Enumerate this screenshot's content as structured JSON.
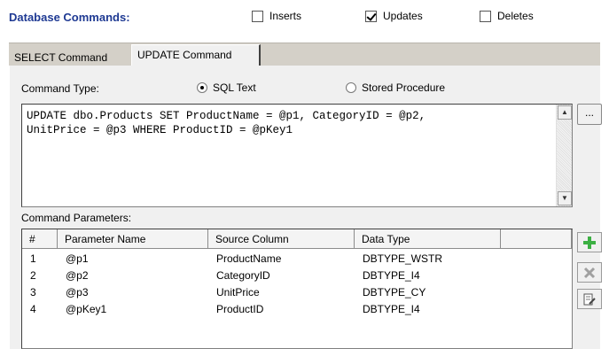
{
  "header": {
    "title": "Database Commands:",
    "checkboxes": [
      {
        "label": "Inserts",
        "checked": false
      },
      {
        "label": "Updates",
        "checked": true
      },
      {
        "label": "Deletes",
        "checked": false
      }
    ]
  },
  "tabs": [
    {
      "label": "SELECT Command",
      "active": false
    },
    {
      "label": "UPDATE Command",
      "active": true
    }
  ],
  "command_type": {
    "label": "Command Type:",
    "options": [
      {
        "label": "SQL Text",
        "selected": true
      },
      {
        "label": "Stored Procedure",
        "selected": false
      }
    ]
  },
  "sql": {
    "text": "UPDATE dbo.Products SET ProductName = @p1, CategoryID = @p2,\nUnitPrice = @p3 WHERE ProductID = @pKey1",
    "ellipsis_label": "..."
  },
  "parameters": {
    "label": "Command Parameters:",
    "columns": [
      "#",
      "Parameter Name",
      "Source Column",
      "Data Type",
      ""
    ],
    "rows": [
      [
        "1",
        "@p1",
        "ProductName",
        "DBTYPE_WSTR"
      ],
      [
        "2",
        "@p2",
        "CategoryID",
        "DBTYPE_I4"
      ],
      [
        "3",
        "@p3",
        "UnitPrice",
        "DBTYPE_CY"
      ],
      [
        "4",
        "@pKey1",
        "ProductID",
        "DBTYPE_I4"
      ]
    ]
  },
  "icons": {
    "add": "plus-icon",
    "delete": "delete-x-icon",
    "edit": "edit-icon"
  },
  "colors": {
    "title": "#1f3a93",
    "add_icon": "#3cb043",
    "delete_icon": "#a0a0a0"
  }
}
